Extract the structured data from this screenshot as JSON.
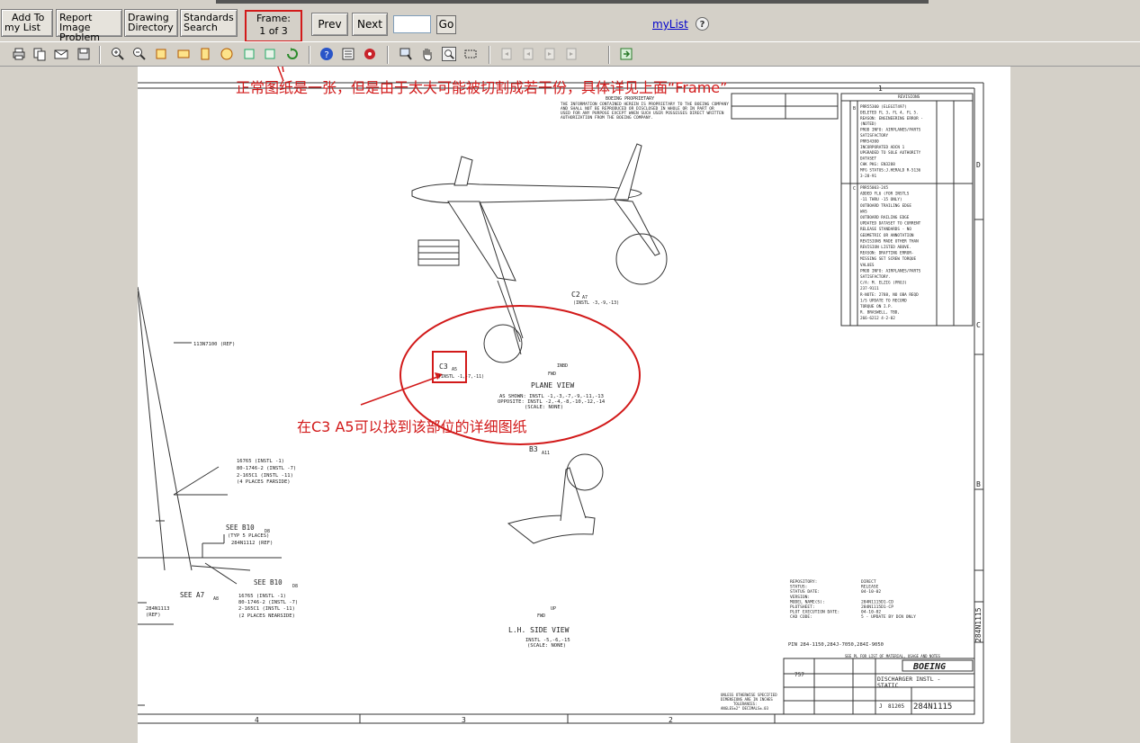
{
  "toolbar_top": {
    "add_to_list": [
      "Add To",
      "my List"
    ],
    "report_image": [
      "Report Image",
      "Problem"
    ],
    "drawing_directory": [
      "Drawing",
      "Directory"
    ],
    "standards_search": [
      "Standards",
      "Search"
    ],
    "frame_label": "Frame:",
    "frame_value": "1 of 3",
    "prev": "Prev",
    "next": "Next",
    "go": "Go",
    "mylist": "myList",
    "help": "?"
  },
  "annotations": {
    "frame_note": "正常图纸是一张，但是由于太大可能被切割成若干份，具体详见上面“Frame”",
    "c3_note": "在C3 A5可以找到该部位的详细图纸"
  },
  "drawing": {
    "plane_view": "PLANE VIEW",
    "plane_view_sub1": "AS SHOWN: INSTL -1,-3,-7,-9,-11,-13",
    "plane_view_sub2": "OPPOSITE: INSTL -2,-4,-8,-10,-12,-14",
    "plane_view_scale": "(SCALE: NONE)",
    "side_view": "L.H. SIDE VIEW",
    "side_view_sub": "INSTL -5,-6,-15",
    "side_view_scale": "(SCALE: NONE)",
    "c2_ref": "C2",
    "c2_sub": "A7",
    "c2_instl": "(INSTL -3,-9,-13)",
    "c3_ref": "C3",
    "c3_sub": "A5",
    "c3_instl": "(INSTL -1,-7,-11)",
    "b3_ref": "B3",
    "b3_sub": "A11",
    "ref_113": "113N7100 (REF)",
    "parts_far_1": "16765 (INSTL -1)",
    "parts_far_2": "80-1746-2 (INSTL -7)",
    "parts_far_3": "2-165C1 (INSTL -11)",
    "parts_far_4": "(4 PLACES FARSIDE)",
    "see_b10_top": "SEE B10",
    "see_b10_sub": "D8",
    "typ5": "(TYP 5 PLACES)",
    "ref_284": "284N1112 (REF)",
    "see_b10_2": "SEE B10",
    "see_a7": "SEE A7",
    "see_a7_sub": "A8",
    "parts_near_1": "16765 (INSTL -1)",
    "parts_near_2": "80-1746-2 (INSTL -7)",
    "parts_near_3": "2-165C1 (INSTL -11)",
    "parts_near_4": "(2 PLACES NEARSIDE)",
    "ref_2841113": "284N1113",
    "ref_left": "(REF)",
    "inbd": "INBD",
    "fwd": "FWD",
    "up": "UP",
    "fwd2": "FWD",
    "zone_4": "4",
    "zone_3": "3",
    "zone_2": "2",
    "zone_1": "1",
    "zone_d": "D",
    "zone_c": "C",
    "zone_b": "B",
    "revisions_title": "REVISIONS",
    "proprietary_title": "BOEING PROPRIETARY",
    "proprietary_text": [
      "THE INFORMATION CONTAINED HEREIN IS PROPRIETARY TO THE BOEING COMPANY",
      "AND SHALL NOT BE REPRODUCED OR DISCLOSED IN WHOLE OR IN PART OR",
      "USED FOR ANY PURPOSE EXCEPT WHEN SUCH USER POSSESSES DIRECT WRITTEN",
      "AUTHORIZATION FROM THE BOEING COMPANY."
    ],
    "rev_b_lines": [
      "PRR55300 (ELEGIT497)",
      "DELETED FL 3, FL 4, FL 5.",
      "REASON: ENGINEERING ERROR -",
      "(NOTED)",
      "PROD INFO: AIRPLANES/PARTS",
      "SATISFACTORY",
      "PRR54300",
      "INCORPORATED ADCN 1",
      "UPGRADED TO SOLE AUTHORITY",
      "DATASET",
      "CHK PKG: EN3288",
      "MFG STATUS:J.HERALD R-5136",
      "3-28-91"
    ],
    "rev_c_lines": [
      "PRR55003-245",
      "ADDED FL6 (FOR INSTLS",
      "-11 THRU -15 ONLY)",
      "OUTBOARD TRAILING EDGE",
      "WAS",
      "OUTBOARD RAILING EDGE",
      "UPDATED DATASET TO CURRENT",
      "RELEASE STANDARDS - NO",
      "GEOMETRIC OR ANNOTATION",
      "REVISIONS MADE OTHER THAN",
      "REVISION LISTED ABOVE.",
      "REASON: DRAFTING ERROR-",
      "MISSING SET SCREW TORQUE",
      "VALUES",
      "PROD INFO: AIRPLANES/PARTS",
      "SATISFACTORY.",
      "C/A: M. ELZIG (PROJ)",
      "237-9111",
      "R-NOTE: 2788, NO OBA REQD",
      "1/S UPDATE TO RECORD",
      "TORQUE ON I.P.",
      "R. BRASWELL, TBD,",
      "266-6212 4-2-02"
    ],
    "repository_labels": [
      "REPOSITORY:",
      "STATUS:",
      "STATUS DATE:",
      "VERSION:",
      "MODEL NAME(S):",
      "PLOTSHEET:",
      "PLOT EXECUTION DATE:",
      "CAD CODE:"
    ],
    "repository_values": [
      "DIRECT",
      "RELEASE",
      "04-10-02",
      "",
      "284N1115D1-CD",
      "284N1115D1-CP",
      "04-10-02",
      "5 - UPDATE BY DCN ONLY"
    ],
    "pin_line": "PIN 284-1150,284J-7050,284I-9050",
    "boeing": "BOEING",
    "title_lines": [
      "DISCHARGER INSTL -",
      "STATIC"
    ],
    "model": "757",
    "drawing_no": "284N1115",
    "size_code": "J",
    "cage": "81205",
    "side_drawing_no": "284N1115",
    "tolerance_note": [
      "UNLESS OTHERWISE SPECIFIED",
      "DIMENSIONS ARE IN INCHES",
      "TOLERANCES:",
      "ANGLES±2°  DECIMALS±.03"
    ],
    "see_parts_list": "SEE PL FOR LIST OF MATERIAL, USAGE AND NOTES"
  }
}
